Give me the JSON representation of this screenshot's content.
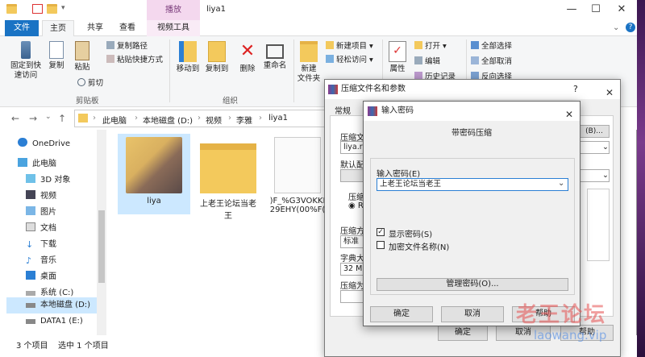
{
  "window": {
    "title": "liya1",
    "context_tab_top": "播放",
    "minimize": "—",
    "maximize": "☐",
    "close": "✕"
  },
  "tabs": {
    "file": "文件",
    "home": "主页",
    "share": "共享",
    "view": "查看",
    "video_tools": "视频工具"
  },
  "ribbon": {
    "pin": "固定到快\n速访问",
    "copy": "复制",
    "paste": "粘贴",
    "copy_path": "复制路径",
    "paste_shortcut": "粘贴快捷方式",
    "cut": "剪切",
    "clipboard_group": "剪贴板",
    "move_to": "移动到",
    "copy_to": "复制到",
    "delete": "删除",
    "rename": "重命名",
    "organize_group": "组织",
    "new_folder": "新建\n文件夹",
    "new_item": "新建项目 ▾",
    "easy_access": "轻松访问 ▾",
    "properties": "属性",
    "open": "打开 ▾",
    "edit": "编辑",
    "history": "历史记录",
    "select_all": "全部选择",
    "select_none": "全部取消",
    "invert_selection": "反向选择"
  },
  "address": {
    "crumbs": [
      "此电脑",
      "本地磁盘 (D:)",
      "视频",
      "李雅",
      "liya1"
    ]
  },
  "nav": {
    "items": [
      "OneDrive",
      "此电脑",
      "3D 对象",
      "视频",
      "图片",
      "文档",
      "下载",
      "音乐",
      "桌面",
      "系统 (C:)",
      "本地磁盘 (D:)",
      "DATA1 (E:)"
    ]
  },
  "files": [
    {
      "name": "liya"
    },
    {
      "name": "上老王论坛当老\n王"
    },
    {
      "name": ")F_%G3VOKKI\n29EHY(00%F("
    }
  ],
  "status": {
    "count": "3 个项目",
    "selected": "选中 1 个项目"
  },
  "archive_dialog": {
    "title": "压缩文件名和参数",
    "help": "?",
    "close": "✕",
    "tab_general": "常规",
    "tab_advanced": "高级",
    "label_archive_name": "压缩文",
    "archive_name_value": "liya.r",
    "browse_button": "(B)...",
    "label_default": "默认配",
    "label_format": "压缩",
    "format_value": "RA",
    "label_method": "压缩方",
    "method_value": "标准",
    "label_dict": "字典大",
    "dict_value": "32 MB",
    "label_split": "压缩为",
    "ok": "确定",
    "cancel": "取消",
    "help_button": "帮助"
  },
  "password_dialog": {
    "title": "输入密码",
    "close": "✕",
    "heading": "带密码压缩",
    "label_password": "输入密码(E)",
    "password_value": "上老王论坛当老王",
    "show_password": "显示密码(S)",
    "show_password_checked": true,
    "encrypt_filenames": "加密文件名称(N)",
    "encrypt_filenames_checked": false,
    "manage_button": "管理密码(O)...",
    "ok": "确定",
    "cancel": "取消",
    "help": "帮助"
  },
  "watermark": {
    "cn": "老王论坛",
    "en": "laowang.vip"
  }
}
